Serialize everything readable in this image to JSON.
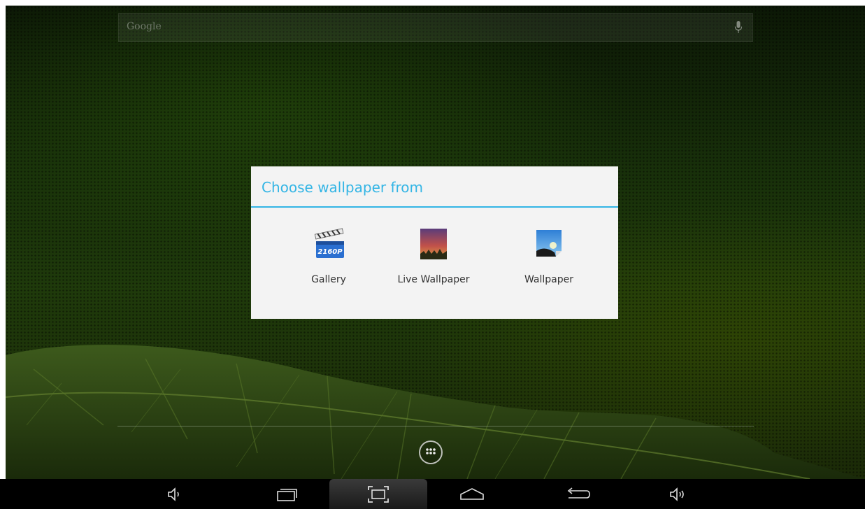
{
  "search": {
    "placeholder": "Google",
    "mic_icon": "mic-icon"
  },
  "dialog": {
    "title": "Choose wallpaper from",
    "accent": "#33b5e5",
    "options": [
      {
        "label": "Gallery",
        "icon": "clapperboard-icon"
      },
      {
        "label": "Live Wallpaper",
        "icon": "sunset-wallpaper-icon"
      },
      {
        "label": "Wallpaper",
        "icon": "picture-icon"
      }
    ],
    "gallery_icon_text": "2160P"
  },
  "dock": {
    "apps_icon": "apps-grid-icon"
  },
  "navbar": {
    "buttons": [
      "volume-down-icon",
      "recent-apps-icon",
      "screenshot-icon",
      "home-icon",
      "back-icon",
      "volume-up-icon"
    ]
  }
}
